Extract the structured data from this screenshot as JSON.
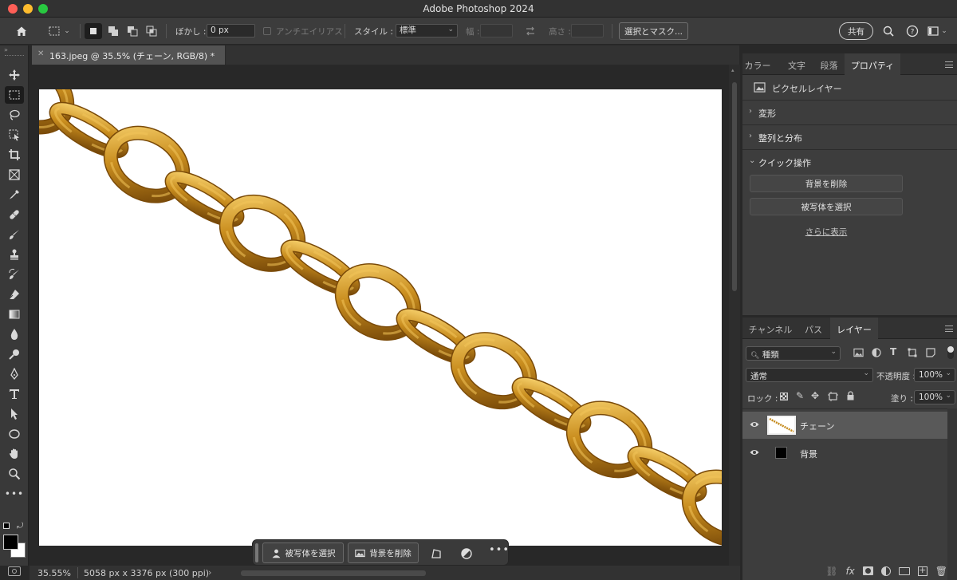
{
  "window": {
    "title": "Adobe Photoshop 2024"
  },
  "options_bar": {
    "feather_label": "ぼかし :",
    "feather_value": "0 px",
    "antialias_label": "アンチエイリアス",
    "style_label": "スタイル :",
    "style_value": "標準",
    "width_label": "幅 :",
    "height_label": "高さ :",
    "select_mask_label": "選択とマスク...",
    "share_label": "共有"
  },
  "document": {
    "tab_label": "163.jpeg @ 35.5% (チェーン, RGB/8) *"
  },
  "status": {
    "zoom": "35.55%",
    "info": "5058 px x 3376 px (300 ppi)"
  },
  "contextual_taskbar": {
    "select_subject": "被写体を選択",
    "remove_background": "背景を削除"
  },
  "properties_panel": {
    "tabs": [
      "カラー",
      "文字",
      "段落",
      "プロパティ"
    ],
    "active_tab": "プロパティ",
    "kind": "ピクセルレイヤー",
    "sections": [
      "変形",
      "整列と分布",
      "クイック操作"
    ],
    "quick_actions": [
      "背景を削除",
      "被写体を選択"
    ],
    "show_more": "さらに表示"
  },
  "layers_panel": {
    "tabs": [
      "チャンネル",
      "パス",
      "レイヤー"
    ],
    "active_tab": "レイヤー",
    "filter_value": "種類",
    "blend_mode": "通常",
    "opacity_label": "不透明度 :",
    "opacity_value": "100%",
    "lock_label": "ロック :",
    "fill_label": "塗り :",
    "fill_value": "100%",
    "layers": [
      {
        "name": "チェーン",
        "selected": true
      },
      {
        "name": "背景",
        "selected": false
      }
    ],
    "fx_label": "fx"
  },
  "colors": {
    "chain_gold": "#c48a1c",
    "chain_highlight": "#f3c45a",
    "chain_shadow": "#7a4a08",
    "panel_bg": "#3d3d3d"
  }
}
